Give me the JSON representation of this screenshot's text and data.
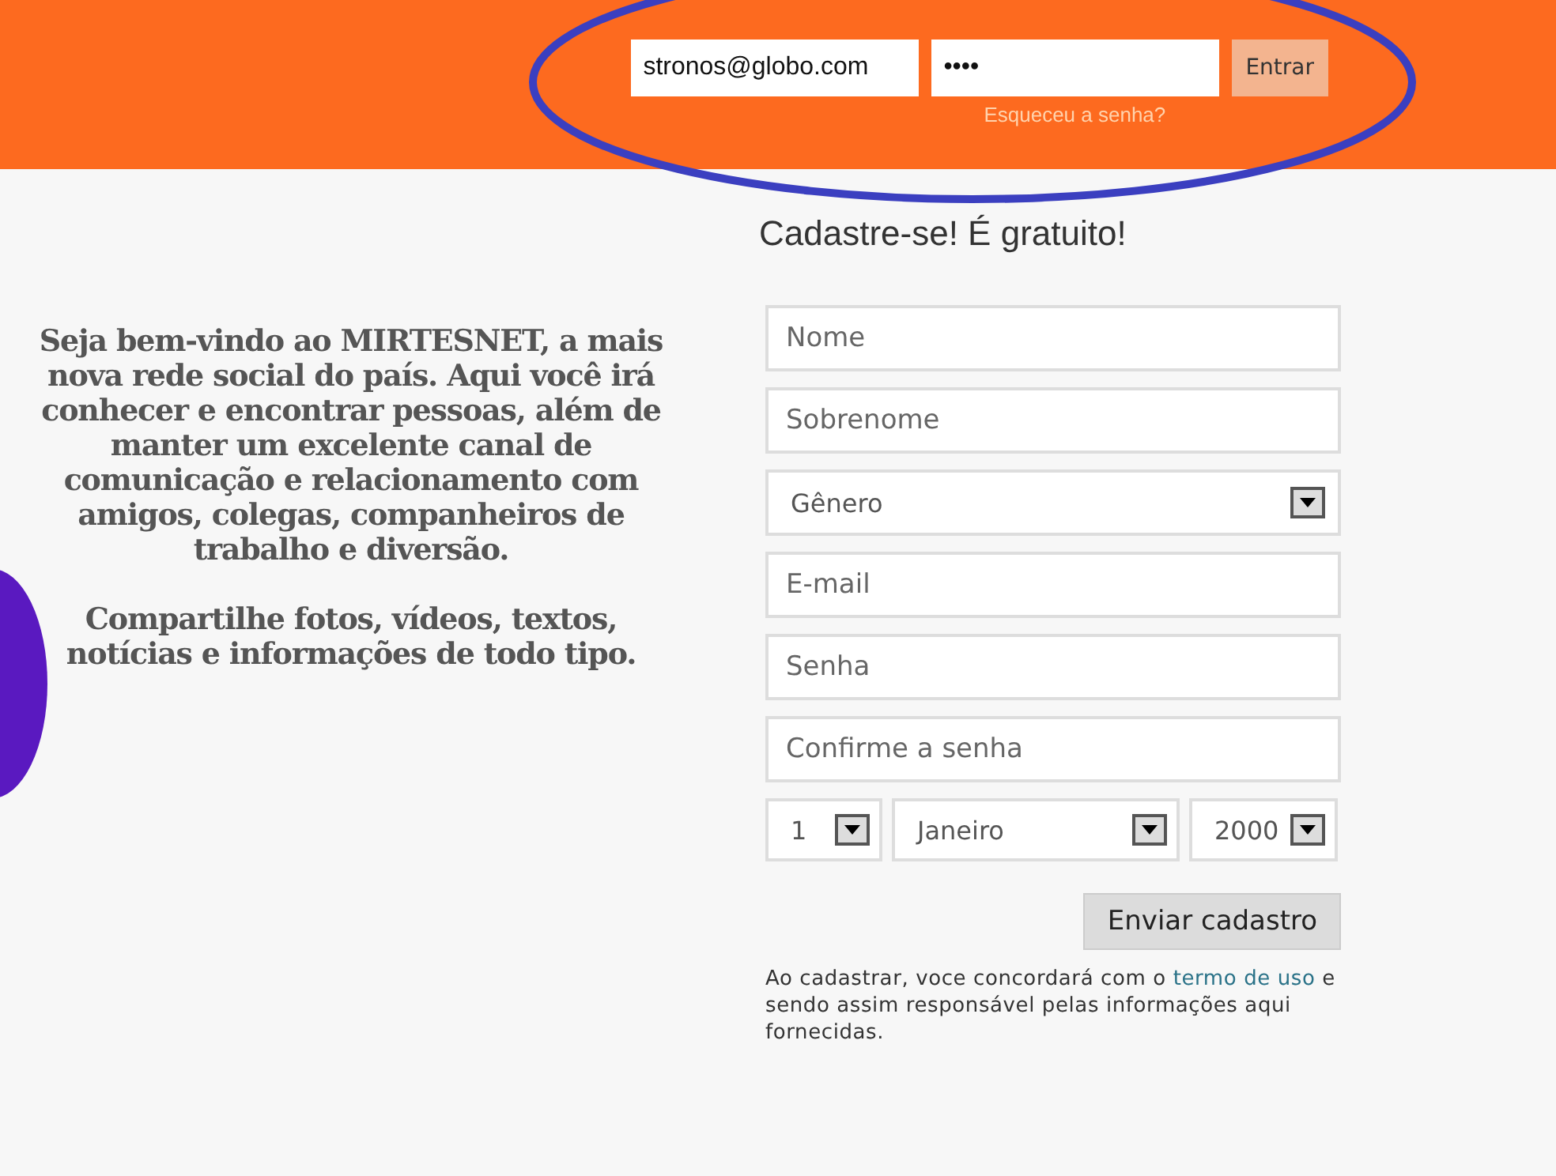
{
  "login": {
    "email": "stronos@globo.com",
    "password": "••••",
    "submit": "Entrar",
    "forgot": "Esqueceu a senha?"
  },
  "intro": {
    "paragraphs": [
      "Seja bem-vindo ao MIRTESNET, a  mais nova rede social do país. Aqui você irá conhecer e encontrar  pessoas, além de manter um  excelente canal de comunicação e  relacionamento com amigos,  colegas, companheiros de trabalho e  diversão.",
      "Compartilhe fotos, vídeos, textos, notícias e informações de todo tipo."
    ]
  },
  "signup": {
    "title": "Cadastre-se! É gratuito!",
    "fields": [
      {
        "kind": "text",
        "placeholder": "Nome"
      },
      {
        "kind": "text",
        "placeholder": "Sobrenome"
      },
      {
        "kind": "select",
        "value": "Gênero"
      },
      {
        "kind": "text",
        "placeholder": "E-mail"
      },
      {
        "kind": "text",
        "placeholder": "Senha"
      },
      {
        "kind": "text",
        "placeholder": "Confirme a senha"
      }
    ],
    "birth": [
      {
        "value": "1"
      },
      {
        "value": "Janeiro"
      },
      {
        "value": "2000"
      }
    ],
    "submit": "Enviar cadastro",
    "terms": {
      "before": "Ao cadastrar, voce concordará com o ",
      "link": "termo de uso",
      "after": " e sendo assim responsável pelas informações aqui fornecidas."
    }
  }
}
